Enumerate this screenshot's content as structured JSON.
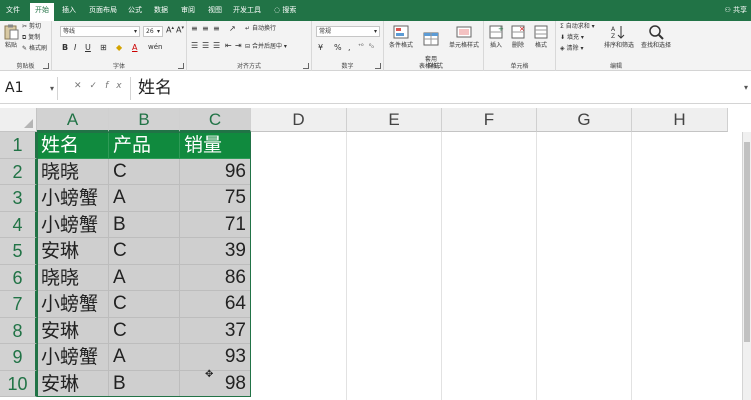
{
  "ribbon_tabs": [
    "文件",
    "开始",
    "插入",
    "页面布局",
    "公式",
    "数据",
    "审阅",
    "视图",
    "开发工具"
  ],
  "search_label": "搜索",
  "share_label": "共享",
  "ribbon": {
    "clipboard": {
      "paste": "粘贴",
      "cut": "剪切",
      "copy": "复制",
      "format_painter": "格式刷",
      "label": "剪贴板"
    },
    "font": {
      "font_name": "等线",
      "font_size": "26",
      "bold": "B",
      "italic": "I",
      "underline": "U",
      "label": "字体"
    },
    "alignment": {
      "wrap_text": "自动换行",
      "merge_center": "合并后居中",
      "label": "对齐方式"
    },
    "number": {
      "format": "常规",
      "currency": "¥",
      "percent": "%",
      "comma": ",",
      "label": "数字"
    },
    "styles": {
      "conditional_format": "条件格式",
      "format_as_table": "套用\n表格格式",
      "cell_styles": "单元格样式",
      "label": "样式"
    },
    "cells": {
      "insert": "插入",
      "delete": "删除",
      "format": "格式",
      "label": "单元格"
    },
    "editing": {
      "autosum": "自动求和",
      "fill": "填充",
      "clear": "清除",
      "sort_filter": "排序和筛选",
      "find_select": "查找和选择",
      "label": "编辑"
    }
  },
  "formula_bar": {
    "name_box": "A1",
    "formula_value": "姓名"
  },
  "columns": [
    "A",
    "B",
    "C",
    "D",
    "E",
    "F",
    "G",
    "H"
  ],
  "rows": [
    "1",
    "2",
    "3",
    "4",
    "5",
    "6",
    "7",
    "8",
    "9",
    "10"
  ],
  "table": {
    "headers": [
      "姓名",
      "产品",
      "销量"
    ],
    "data": [
      [
        "晓晓",
        "C",
        "96"
      ],
      [
        "小螃蟹",
        "A",
        "75"
      ],
      [
        "小螃蟹",
        "B",
        "71"
      ],
      [
        "安琳",
        "C",
        "39"
      ],
      [
        "晓晓",
        "A",
        "86"
      ],
      [
        "小螃蟹",
        "C",
        "64"
      ],
      [
        "安琳",
        "C",
        "37"
      ],
      [
        "小螃蟹",
        "A",
        "93"
      ],
      [
        "安琳",
        "B",
        "98"
      ]
    ]
  },
  "colors": {
    "accent": "#217346",
    "header_fill": "#108a3e"
  }
}
